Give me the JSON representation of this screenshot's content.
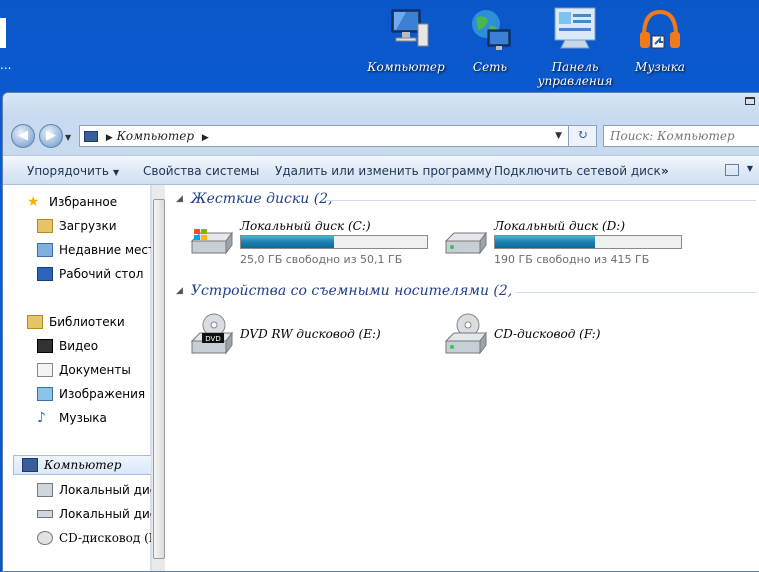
{
  "desktop": {
    "edge_text": "...",
    "icons": [
      {
        "id": "computer",
        "label": "Компьютер"
      },
      {
        "id": "network",
        "label": "Сеть"
      },
      {
        "id": "control-panel",
        "label": "Панель управления"
      },
      {
        "id": "music",
        "label": "Музыка"
      }
    ]
  },
  "window": {
    "address": {
      "path": "Компьютер"
    },
    "search": {
      "placeholder": "Поиск: Компьютер"
    },
    "toolbar": {
      "organize": "Упорядочить",
      "system_properties": "Свойства системы",
      "uninstall": "Удалить или изменить программу",
      "map_drive": "Подключить сетевой диск",
      "more": "»"
    },
    "nav_pane": {
      "favorites": "Избранное",
      "downloads": "Загрузки",
      "recent": "Недавние мест",
      "desktop": "Рабочий стол",
      "libraries": "Библиотеки",
      "video": "Видео",
      "documents": "Документы",
      "images": "Изображения",
      "music": "Музыка",
      "computer": "Компьютер",
      "local_c": "Локальный дис",
      "local_d": "Локальный дис",
      "cd": "CD-дисковод (F"
    },
    "groups": {
      "hard_drives": "Жесткие диски (2,",
      "removable": "Устройства со съемными носителями (2,"
    },
    "drives": [
      {
        "name": "Локальный диск (C:)",
        "free_text": "25,0 ГБ свободно из 50,1 ГБ",
        "used_fraction": 0.5
      },
      {
        "name": "Локальный диск (D:)",
        "free_text": "190 ГБ свободно из 415 ГБ",
        "used_fraction": 0.54
      }
    ],
    "removable_devices": [
      {
        "name": "DVD RW дисковод (E:)",
        "badge": "DVD"
      },
      {
        "name": "CD-дисковод (F:)"
      }
    ]
  }
}
